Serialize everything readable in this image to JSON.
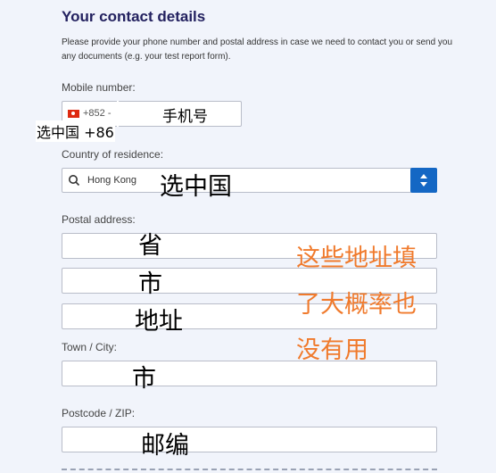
{
  "form": {
    "title": "Your contact details",
    "intro": "Please provide your phone number and postal address in case we need to contact you or send you any documents (e.g. your test report form).",
    "mobile_label": "Mobile number:",
    "dial_code": "+852 -",
    "country_label": "Country of residence:",
    "country_value": "Hong Kong",
    "postal_label": "Postal address:",
    "town_label": "Town / City:",
    "postcode_label": "Postcode / ZIP:"
  },
  "annotations": {
    "phone_note": "手机号",
    "country_code_note": "选中国 +86",
    "country_note": "选中国",
    "postal_line1": "省",
    "postal_line2": "市",
    "postal_line3": "地址",
    "town_note": "市",
    "postcode_note": "邮编",
    "comment_lines": [
      "这些地址填",
      "了大概率也",
      "没有用"
    ]
  },
  "colors": {
    "title": "#23215f",
    "accent": "#1467c4",
    "annotation": "#f07a2c"
  },
  "icons": {
    "flag": "hong-kong-flag-icon",
    "search": "search-icon",
    "spinner": "select-arrows-icon"
  }
}
